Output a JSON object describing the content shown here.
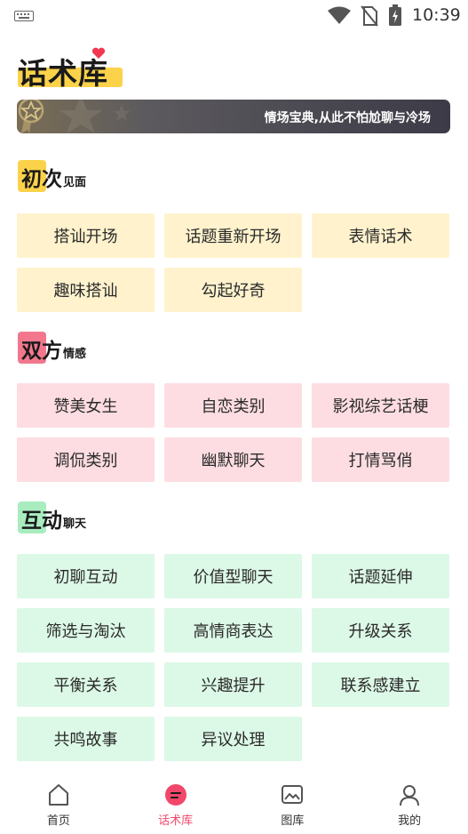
{
  "status_bar": {
    "time": "10:39"
  },
  "header": {
    "title": "话术库"
  },
  "banner": {
    "text": "情场宝典,从此不怕尬聊与冷场"
  },
  "sections": [
    {
      "title": "初次",
      "subtitle": "见面",
      "color": "#fbd24a",
      "tags": [
        "搭讪开场",
        "话题重新开场",
        "表情话术",
        "趣味搭讪",
        "勾起好奇"
      ]
    },
    {
      "title": "双方",
      "subtitle": "情感",
      "color": "#f2778d",
      "tags": [
        "赞美女生",
        "自恋类别",
        "影视综艺话梗",
        "调侃类别",
        "幽默聊天",
        "打情骂俏"
      ]
    },
    {
      "title": "互动",
      "subtitle": "聊天",
      "color": "#a8ecc0",
      "tags": [
        "初聊互动",
        "价值型聊天",
        "话题延伸",
        "筛选与淘汰",
        "高情商表达",
        "升级关系",
        "平衡关系",
        "兴趣提升",
        "联系感建立",
        "共鸣故事",
        "异议处理"
      ]
    }
  ],
  "bottom_nav": [
    {
      "label": "首页",
      "icon": "home-icon",
      "active": false
    },
    {
      "label": "话术库",
      "icon": "chat-bubble-icon",
      "active": true
    },
    {
      "label": "图库",
      "icon": "image-icon",
      "active": false
    },
    {
      "label": "我的",
      "icon": "user-icon",
      "active": false
    }
  ],
  "colors": {
    "accent": "#f2476a",
    "yellow": "#fff2cd",
    "pink": "#fddde2",
    "green": "#dcf8e6"
  }
}
